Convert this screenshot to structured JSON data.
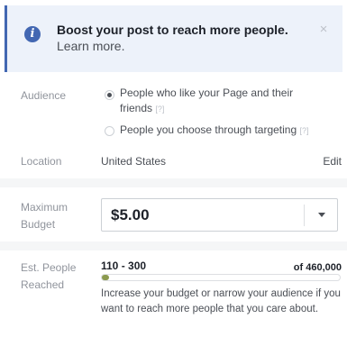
{
  "banner": {
    "title_bold": "Boost your post to reach more people.",
    "link": "Learn more.",
    "close_symbol": "×",
    "info_icon": "info-icon",
    "accent": "#4267b2"
  },
  "audience": {
    "label": "Audience",
    "options": [
      {
        "label": "People who like your Page and their friends",
        "help": "[?]",
        "selected": true
      },
      {
        "label": "People you choose through targeting",
        "help": "[?]",
        "selected": false
      }
    ]
  },
  "location": {
    "label": "Location",
    "value": "United States",
    "edit": "Edit"
  },
  "budget": {
    "label_line1": "Maximum",
    "label_line2": "Budget",
    "value": "$5.00"
  },
  "reach": {
    "label_line1": "Est. People",
    "label_line2": "Reached",
    "range": "110 - 300",
    "total": "of 460,000",
    "fraction": 0.0007,
    "hint": "Increase your budget or narrow your audience if you want to reach more people that you care about."
  }
}
